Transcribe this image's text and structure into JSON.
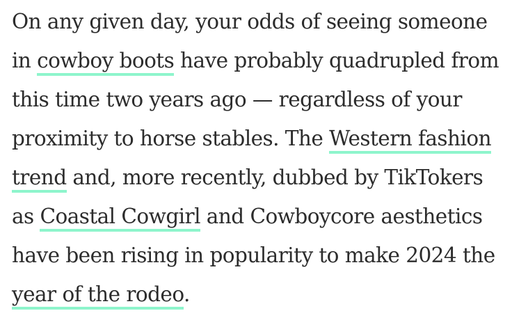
{
  "paragraph": {
    "text_1": "On any given day, your odds of seeing someone in ",
    "link_cowboy_boots": "cowboy boots",
    "text_2": " have probably quadrupled from this time two years ago — regardless of your proximity to horse stables. The ",
    "link_western_fashion": "Western fashion trend",
    "text_3": " and, more recently, dubbed by TikTokers as ",
    "link_coastal_cowgirl": "Coastal Cowgirl",
    "text_4": " and Cowboycore aesthetics have been rising in popularity to make 2024 the ",
    "link_year_of_rodeo": "year of the rodeo",
    "text_5": "."
  },
  "colors": {
    "text": "#2c2c2c",
    "link_underline": "#8ef5cc",
    "background": "#ffffff"
  }
}
